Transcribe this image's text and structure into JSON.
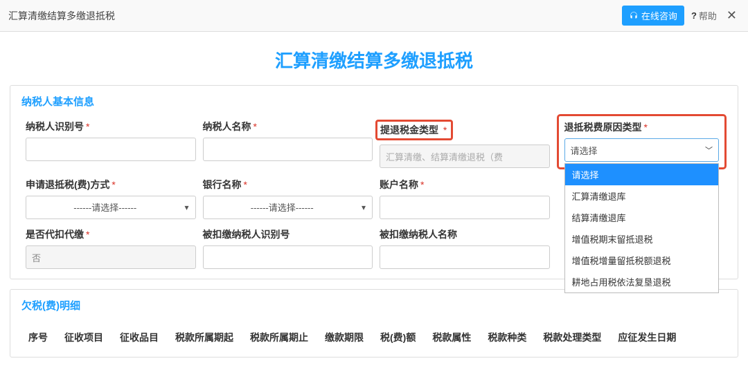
{
  "header": {
    "title": "汇算清缴结算多缴退抵税",
    "consult": "在线咨询",
    "help": "帮助"
  },
  "page_title": "汇算清缴结算多缴退抵税",
  "panel_basic": {
    "title": "纳税人基本信息",
    "fields": {
      "taxpayer_id": {
        "label": "纳税人识别号",
        "required": true,
        "value": ""
      },
      "taxpayer_name": {
        "label": "纳税人名称",
        "required": true,
        "value": ""
      },
      "refund_tax_type": {
        "label": "提退税金类型",
        "required": true,
        "value": "汇算清缴、结算清缴退税（费"
      },
      "refund_reason_type": {
        "label": "退抵税费原因类型",
        "required": true,
        "placeholder": "请选择",
        "options": [
          "请选择",
          "汇算清缴退库",
          "结算清缴退库",
          "增值税期末留抵退税",
          "增值税增量留抵税额退税",
          "耕地占用税依法复垦退税"
        ]
      },
      "apply_method": {
        "label": "申请退抵税(费)方式",
        "required": true,
        "value": "------请选择------"
      },
      "bank_name": {
        "label": "银行名称",
        "required": true,
        "value": "------请选择------"
      },
      "account_name": {
        "label": "账户名称",
        "required": true,
        "value": ""
      },
      "is_withhold": {
        "label": "是否代扣代缴",
        "required": true,
        "value": "否"
      },
      "withhold_id": {
        "label": "被扣缴纳税人识别号",
        "required": false,
        "value": ""
      },
      "withhold_name": {
        "label": "被扣缴纳税人名称",
        "required": false,
        "value": ""
      }
    }
  },
  "panel_details": {
    "title": "欠税(费)明细",
    "columns": [
      "序号",
      "征收项目",
      "征收品目",
      "税款所属期起",
      "税款所属期止",
      "缴款期限",
      "税(费)额",
      "税款属性",
      "税款种类",
      "税款处理类型",
      "应征发生日期"
    ]
  }
}
